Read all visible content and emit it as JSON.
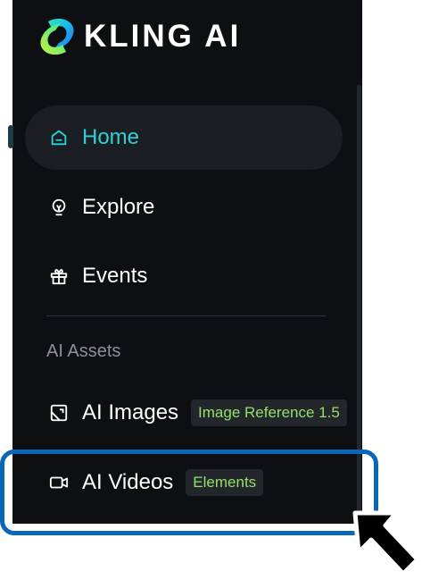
{
  "app": {
    "logo_text": "KLING AI"
  },
  "nav": {
    "home": {
      "label": "Home",
      "icon": "home-icon"
    },
    "explore": {
      "label": "Explore",
      "icon": "lightbulb-icon"
    },
    "events": {
      "label": "Events",
      "icon": "gift-icon"
    }
  },
  "section": {
    "label": "AI Assets"
  },
  "assets": {
    "images": {
      "label": "AI Images",
      "badge": "Image Reference 1.5",
      "icon": "image-icon"
    },
    "videos": {
      "label": "AI Videos",
      "badge": "Elements",
      "icon": "video-camera-icon"
    }
  },
  "colors": {
    "accent": "#2fd1d6",
    "badge_text": "#94e06a",
    "highlight": "#0a66b8",
    "sidebar_bg": "#0d0f13"
  }
}
